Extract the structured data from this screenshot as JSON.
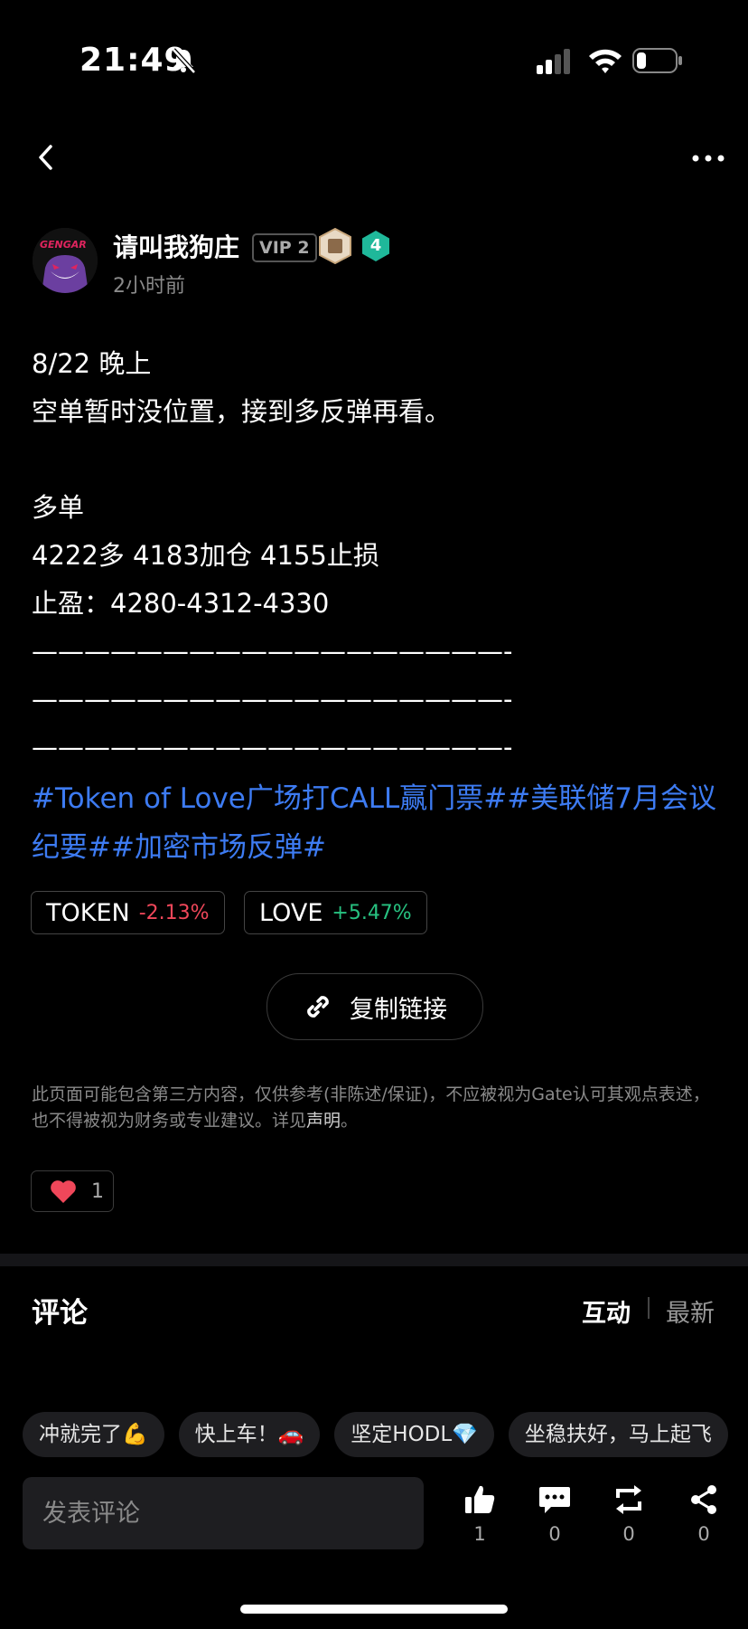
{
  "status_bar": {
    "time": "21:49"
  },
  "author": {
    "name": "请叫我狗庄",
    "vip": "VIP 2",
    "level": "4",
    "posted": "2小时前",
    "avatar_text": "GENGAR"
  },
  "post": {
    "lines": [
      "8/22  晚上",
      "空单暂时没位置，接到多反弹再看。",
      "",
      "多单",
      "4222多 4183加仓 4155止损",
      "止盈：4280-4312-4330",
      "——————————————————-",
      "——————————————————-",
      "——————————————————-"
    ],
    "tags": "#Token of Love广场打CALL赢门票##美联储7月会议纪要##加密市场反弹#"
  },
  "tickers": [
    {
      "symbol": "TOKEN",
      "change": "-2.13%",
      "color": "#f0475a"
    },
    {
      "symbol": "LOVE",
      "change": "+5.47%",
      "color": "#27c281"
    }
  ],
  "copy_link_label": "复制链接",
  "disclaimer": {
    "text": "此页面可能包含第三方内容，仅供参考(非陈述/保证)，不应被视为Gate认可其观点表述，也不得被视为财务或专业建议。详见",
    "link": "声明",
    "end": "。"
  },
  "likes": "1",
  "comments": {
    "title": "评论",
    "sort_active": "互动",
    "sort_other": "最新",
    "quick_replies": [
      "冲就完了💪",
      "快上车！🚗",
      "坚定HODL💎",
      "坐稳扶好，马上起飞"
    ],
    "input_placeholder": "发表评论"
  },
  "actions": [
    {
      "icon": "thumbs-up-icon",
      "count": "1"
    },
    {
      "icon": "comment-icon",
      "count": "0"
    },
    {
      "icon": "repost-icon",
      "count": "0"
    },
    {
      "icon": "share-icon",
      "count": "0"
    }
  ],
  "colors": {
    "background": "#000000",
    "tag_blue": "#3d7bf2",
    "negative": "#f0475a",
    "positive": "#27c281"
  }
}
